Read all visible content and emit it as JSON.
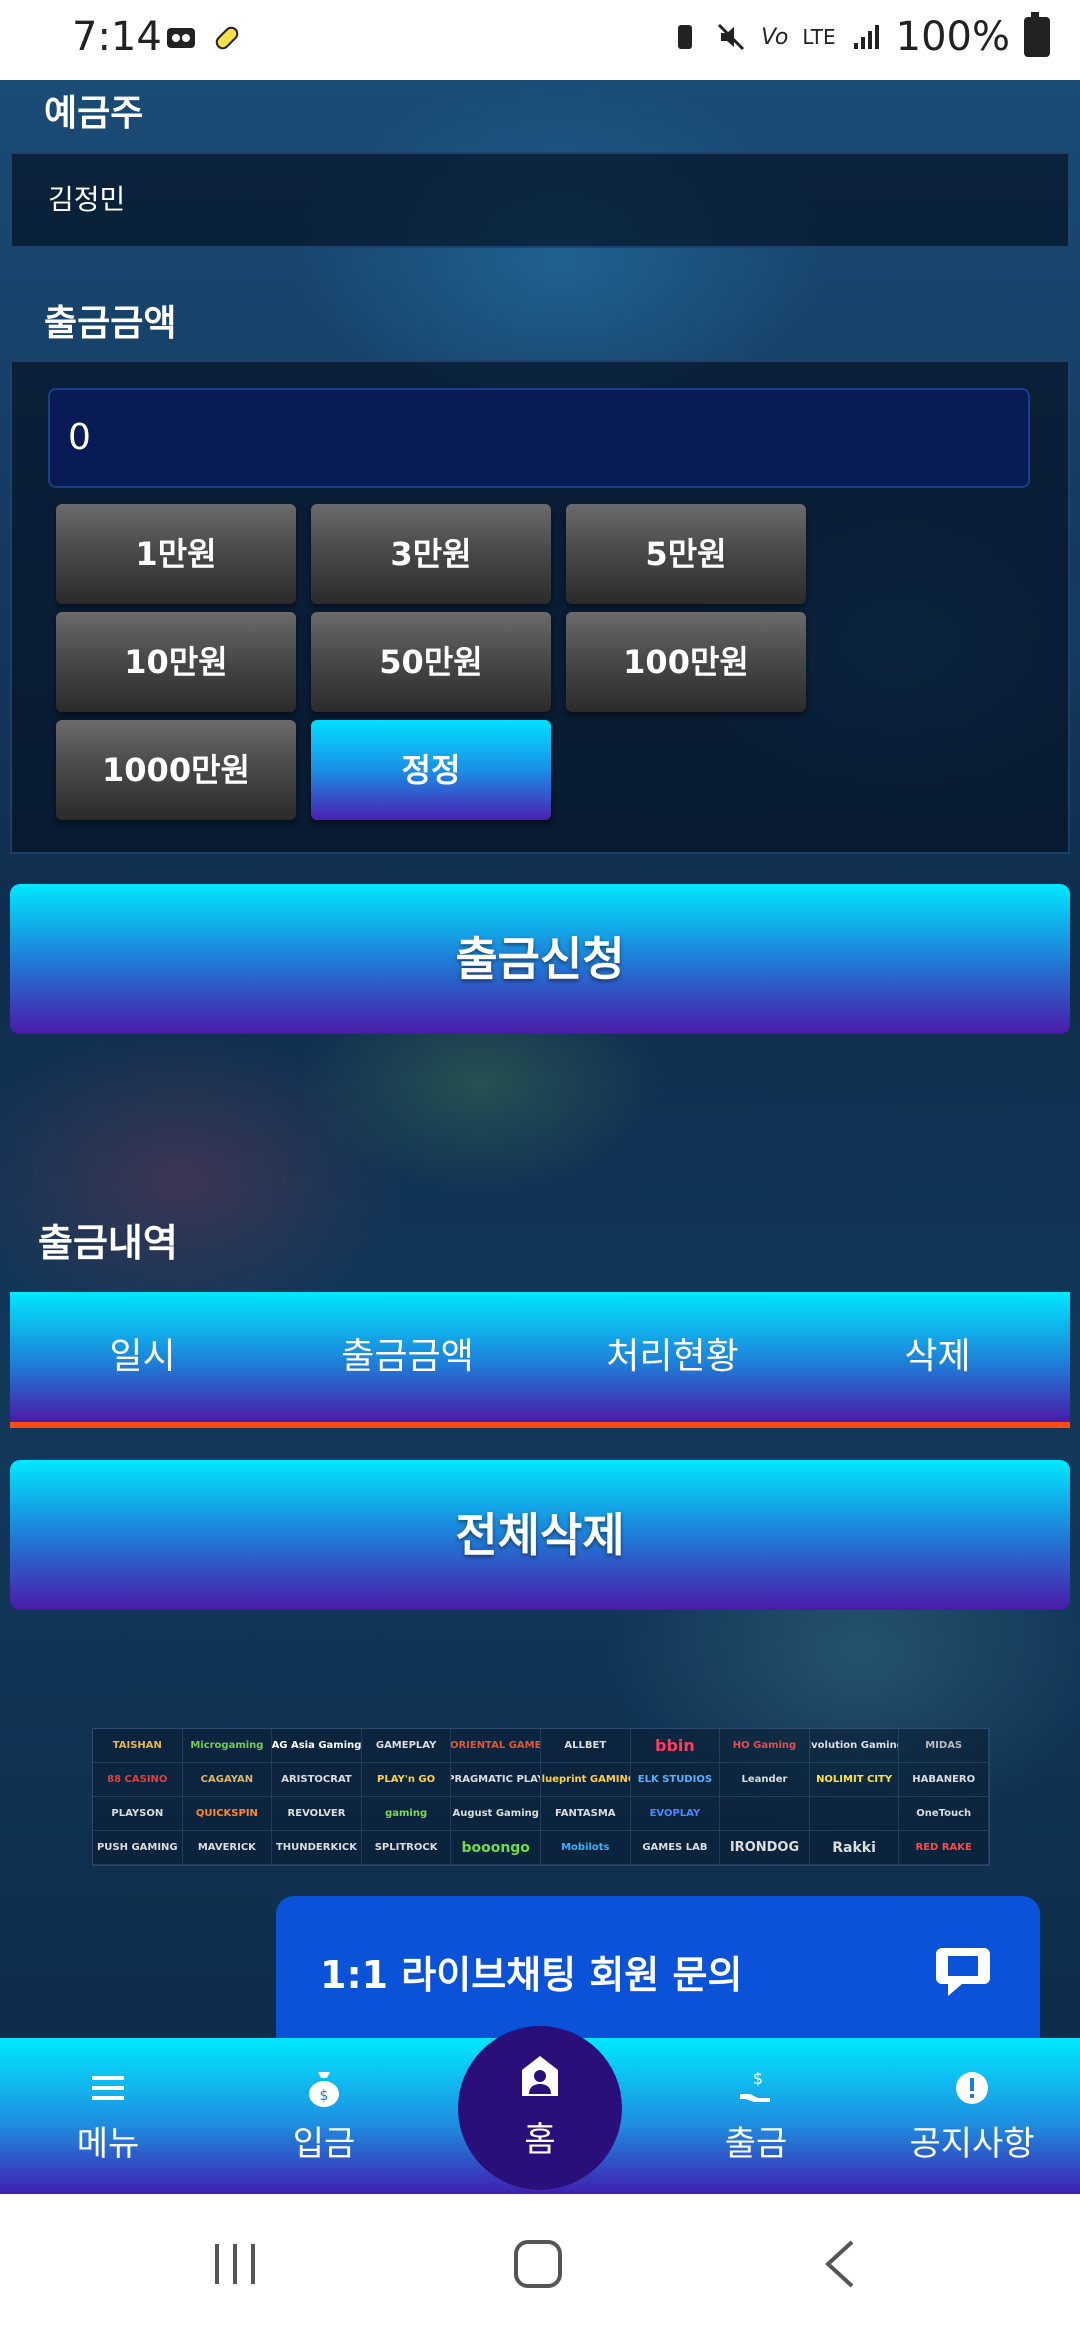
{
  "status_bar": {
    "time": "7:14",
    "battery": "100%",
    "network": "LTE"
  },
  "account": {
    "holder_label": "예금주",
    "holder_name": "김정민"
  },
  "withdraw": {
    "amount_label": "출금금액",
    "amount_value": "0",
    "chips": [
      "1만원",
      "3만원",
      "5만원",
      "10만원",
      "50만원",
      "100만원",
      "1000만원"
    ],
    "reset_label": "정정",
    "submit_label": "출금신청"
  },
  "history": {
    "title": "출금내역",
    "columns": [
      "일시",
      "출금금액",
      "처리현황",
      "삭제"
    ],
    "delete_all_label": "전체삭제"
  },
  "providers": [
    "TAISHAN",
    "Microgaming",
    "AG Asia Gaming",
    "GAMEPLAY",
    "ORIENTAL GAME",
    "ALLBET",
    "bbin",
    "HO Gaming",
    "Evolution Gaming",
    "MIDAS",
    "88 CASINO",
    "CAGAYAN",
    "ARISTOCRAT",
    "PLAY'n GO",
    "PRAGMATIC PLAY",
    "blueprint GAMING",
    "ELK STUDIOS",
    "Leander",
    "NOLIMIT CITY",
    "HABANERO",
    "PLAYSON",
    "QUICKSPIN",
    "REVOLVER",
    "gaming",
    "August Gaming",
    "FANTASMA",
    "EVOPLAY",
    "",
    "",
    "OneTouch",
    "PUSH GAMING",
    "MAVERICK",
    "THUNDERKICK",
    "SPLITROCK",
    "booongo",
    "Mobilots",
    "GAMES LAB",
    "IRONDOG",
    "Rakki",
    "RED RAKE"
  ],
  "chat_banner": {
    "label": "1:1 라이브채팅 회원 문의",
    "icon": "chat-bubble-icon"
  },
  "bottom_nav": {
    "menu": "메뉴",
    "deposit": "입금",
    "home": "홈",
    "withdraw": "출금",
    "notice": "공지사항"
  },
  "colors": {
    "accent_cyan": "#00e8ff",
    "accent_purple": "#4b1aa8",
    "history_underline": "#ff4a10",
    "chat_blue": "#0a52d8"
  }
}
